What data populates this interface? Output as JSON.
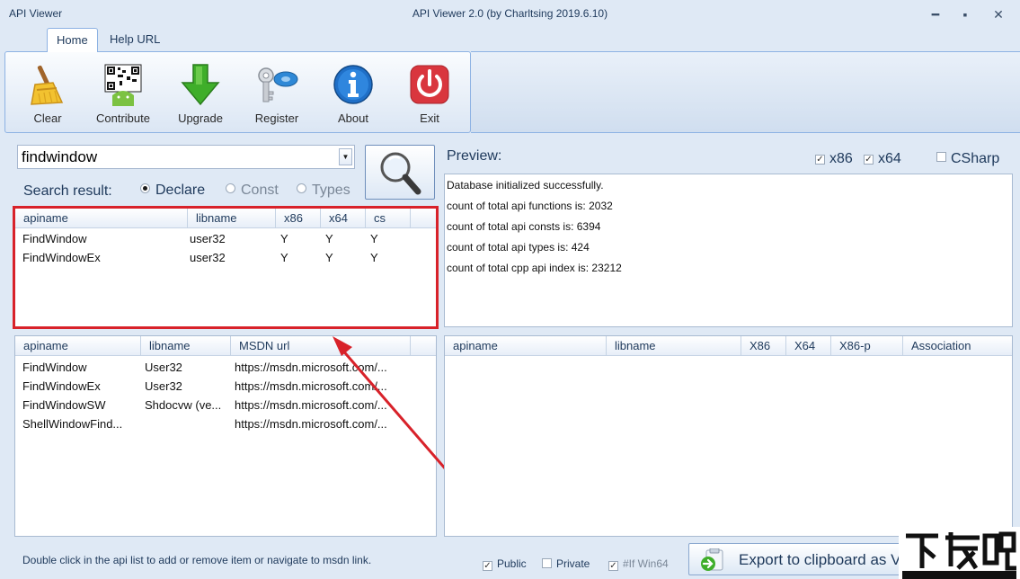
{
  "window": {
    "app_title": "API Viewer",
    "title": "API Viewer 2.0 (by Charltsing 2019.6.10)",
    "minimize": "━",
    "maximize": "▪",
    "close": "✕"
  },
  "ribbon": {
    "tabs": [
      "Home",
      "Help URL"
    ],
    "buttons": [
      {
        "label": "Clear",
        "icon": "broom-icon"
      },
      {
        "label": "Contribute",
        "icon": "qr-android-icon"
      },
      {
        "label": "Upgrade",
        "icon": "down-arrow-icon"
      },
      {
        "label": "Register",
        "icon": "key-icon"
      },
      {
        "label": "About",
        "icon": "info-icon"
      },
      {
        "label": "Exit",
        "icon": "power-icon"
      }
    ]
  },
  "search": {
    "value": "findwindow",
    "result_label": "Search result:",
    "options": [
      "Declare",
      "Const",
      "Types"
    ],
    "selected": "Declare"
  },
  "result_table": {
    "columns": [
      "apiname",
      "libname",
      "x86",
      "x64",
      "cs"
    ],
    "rows": [
      [
        "FindWindow",
        "user32",
        "Y",
        "Y",
        "Y"
      ],
      [
        "FindWindowEx",
        "user32",
        "Y",
        "Y",
        "Y"
      ]
    ]
  },
  "msdn_table": {
    "columns": [
      "apiname",
      "libname",
      "MSDN url"
    ],
    "rows": [
      [
        "FindWindow",
        "User32",
        "https://msdn.microsoft.com/..."
      ],
      [
        "FindWindowEx",
        "User32",
        "https://msdn.microsoft.com/..."
      ],
      [
        "FindWindowSW",
        "Shdocvw (ve...",
        "https://msdn.microsoft.com/..."
      ],
      [
        "ShellWindowFind...",
        "",
        "https://msdn.microsoft.com/..."
      ]
    ]
  },
  "preview": {
    "label": "Preview:",
    "x86": "x86",
    "x64": "x64",
    "csharp": "CSharp",
    "x86_checked": true,
    "x64_checked": true,
    "csharp_checked": false,
    "lines": [
      "Database initialized successfully.",
      "count of total api functions is: 2032",
      "count of total api consts is: 6394",
      "count of total api types is: 424",
      "count of total cpp api index is: 23212"
    ]
  },
  "selected_table": {
    "columns": [
      "apiname",
      "libname",
      "X86",
      "X64",
      "X86-p",
      "Association"
    ]
  },
  "footer": {
    "status": "Double click in the api list to add or remove item or navigate to msdn link.",
    "public": "Public",
    "private": "Private",
    "win64": "#If Win64",
    "public_checked": true,
    "private_checked": false,
    "win64_checked": true,
    "export": "Export to clipboard as V"
  },
  "colors": {
    "highlight": "#d8222a",
    "background": "#dfe9f5",
    "border": "#a8bad1"
  }
}
